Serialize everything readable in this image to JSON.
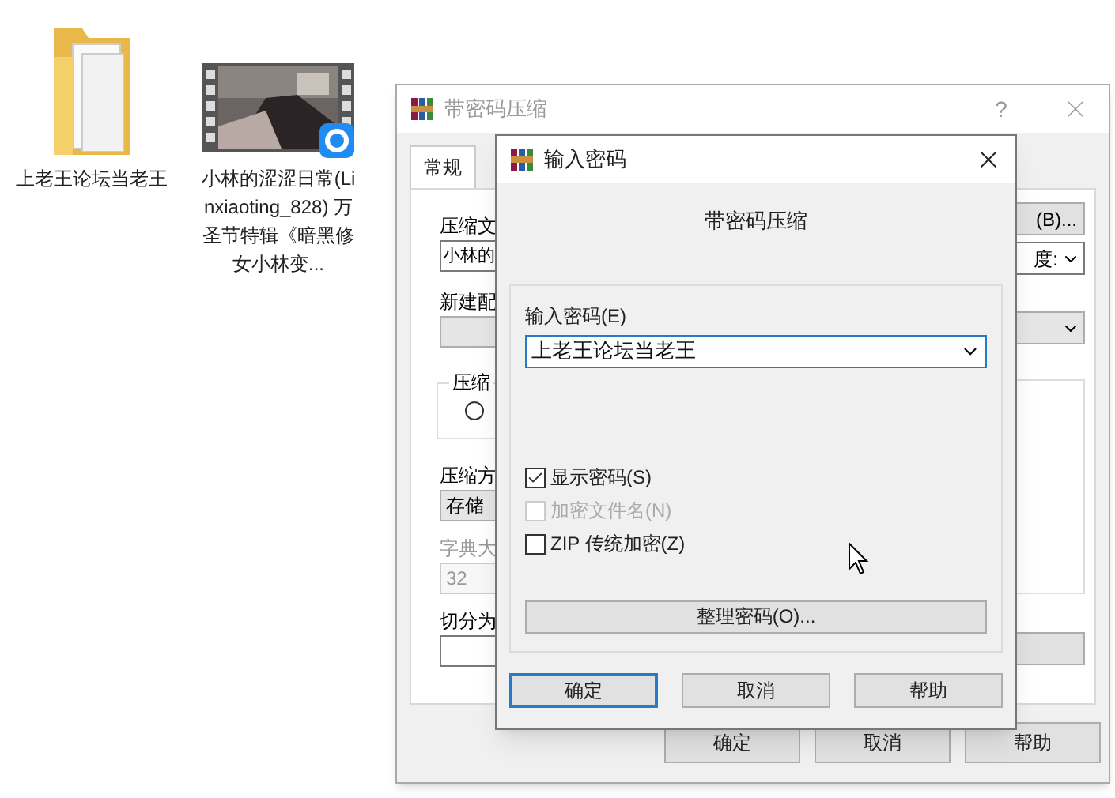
{
  "desktop_icons": [
    {
      "kind": "folder",
      "label": "上老王论坛当老王"
    },
    {
      "kind": "video",
      "label": "小林的涩涩日常(Linxiaoting_828) 万圣节特辑《暗黑修女小林变..."
    }
  ],
  "back_window": {
    "title": "带密码压缩",
    "help": "?",
    "tabs": [
      {
        "label": "常规",
        "selected": true
      }
    ],
    "archive_label": "压缩文",
    "archive_value": "小林的",
    "browse_button": "(B)...",
    "right_combo_value": "度:",
    "profile_label": "新建配",
    "group_label": "压缩",
    "radio": {
      "selected": false
    },
    "method_label": "压缩方",
    "method_value": "存储",
    "dictionary": {
      "label": "字典大",
      "value": "32",
      "disabled": true
    },
    "split_label": "切分为",
    "buttons": [
      {
        "label": "确定"
      },
      {
        "label": "取消"
      },
      {
        "label": "帮助"
      }
    ]
  },
  "password_dialog": {
    "title": "输入密码",
    "heading": "带密码压缩",
    "password_label": "输入密码(E)",
    "password_value": "上老王论坛当老王",
    "options": [
      {
        "label": "显示密码(S)",
        "checked": true,
        "disabled": false
      },
      {
        "label": "加密文件名(N)",
        "checked": false,
        "disabled": true
      },
      {
        "label": "ZIP 传统加密(Z)",
        "checked": false,
        "disabled": false
      }
    ],
    "organize_button": "整理密码(O)...",
    "buttons": [
      {
        "label": "确定",
        "selected": true
      },
      {
        "label": "取消",
        "selected": false
      },
      {
        "label": "帮助",
        "selected": false
      }
    ]
  }
}
